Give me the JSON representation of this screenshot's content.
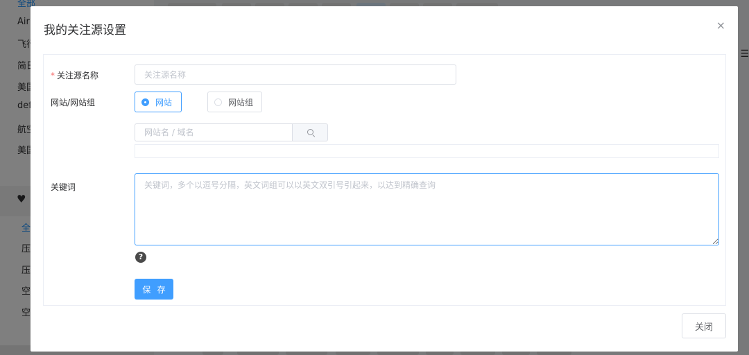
{
  "background": {
    "sidebar": {
      "items": [
        "全部",
        "Airl",
        "飞行",
        "简日",
        "美国",
        "def",
        "航空",
        "美国"
      ],
      "heart_icon": "heart-icon",
      "sub_items": [
        "全",
        "压",
        "压",
        "空",
        "空"
      ]
    }
  },
  "modal": {
    "title": "我的关注源设置",
    "close_icon": "×",
    "form": {
      "name_label": "关注源名称",
      "name_required_mark": "*",
      "name_placeholder": "关注源名称",
      "name_value": "",
      "type_label": "网站/网站组",
      "type_options": [
        {
          "label": "网站",
          "checked": true
        },
        {
          "label": "网站组",
          "checked": false
        }
      ],
      "site_search_placeholder": "网站名 / 域名",
      "site_search_value": "",
      "keyword_label": "关键词",
      "keyword_placeholder": "关键词，多个以逗号分隔，英文词组可以以英文双引号引起来，以达到精确查询",
      "keyword_value": "",
      "help_icon": "?",
      "save_label": "保 存"
    },
    "footer": {
      "close_label": "关闭"
    }
  },
  "colors": {
    "primary": "#409eff",
    "required": "#f56c6c",
    "border": "#dcdfe6"
  }
}
